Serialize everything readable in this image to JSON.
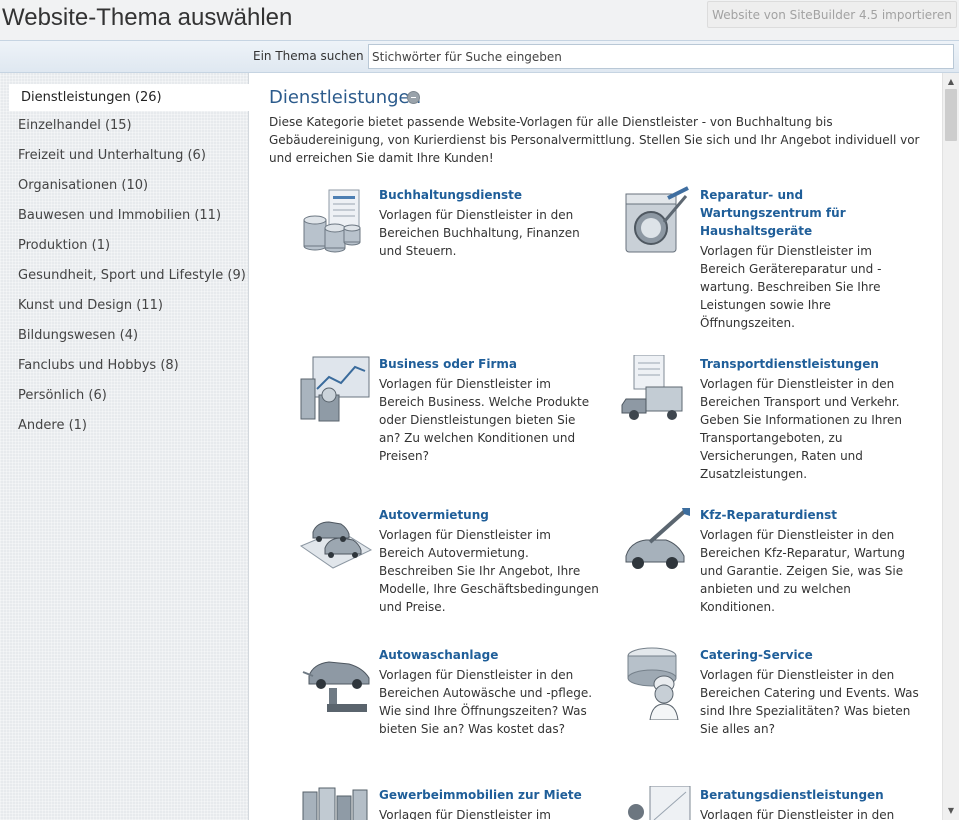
{
  "header": {
    "title": "Website-Thema auswählen",
    "import_button": "Website von SiteBuilder 4.5 importieren"
  },
  "search": {
    "label": "Ein Thema suchen",
    "placeholder": "Stichwörter für Suche eingeben"
  },
  "sidebar": {
    "items": [
      {
        "label": "Dienstleistungen (26)",
        "active": true
      },
      {
        "label": "Einzelhandel (15)"
      },
      {
        "label": "Freizeit und Unterhaltung (6)"
      },
      {
        "label": "Organisationen (10)"
      },
      {
        "label": "Bauwesen und Immobilien (11)"
      },
      {
        "label": "Produktion (1)"
      },
      {
        "label": "Gesundheit, Sport und Lifestyle (9)"
      },
      {
        "label": "Kunst und Design (11)"
      },
      {
        "label": "Bildungswesen (4)"
      },
      {
        "label": "Fanclubs und Hobbys (8)"
      },
      {
        "label": "Persönlich (6)"
      },
      {
        "label": "Andere (1)"
      }
    ]
  },
  "main": {
    "category_title": "Dienstleistungen",
    "category_description": "Diese Kategorie bietet passende Website-Vorlagen für alle Dienstleister - von Buchhaltung bis Gebäudereinigung, von Kurierdienst bis Personalvermittlung. Stellen Sie sich und Ihr Angebot individuell vor und erreichen Sie damit Ihre Kunden!",
    "templates": [
      {
        "title": "Buchhaltungsdienste",
        "icon": "accounting-icon",
        "desc": "Vorlagen für Dienstleister in den Bereichen Buchhaltung, Finanzen und Steuern."
      },
      {
        "title": "Reparatur- und Wartungszentrum für Haushaltsgeräte",
        "icon": "appliance-repair-icon",
        "desc": "Vorlagen für Dienstleister im Bereich Gerätereparatur und -wartung. Beschreiben Sie Ihre Leistungen sowie Ihre Öffnungszeiten."
      },
      {
        "title": "Business oder Firma",
        "icon": "business-icon",
        "desc": "Vorlagen für Dienstleister im Bereich Business. Welche Produkte oder Dienstleistungen bieten Sie an? Zu welchen Konditionen und Preisen?"
      },
      {
        "title": "Transportdienstleistungen",
        "icon": "truck-icon",
        "desc": "Vorlagen für Dienstleister in den Bereichen Transport und Verkehr. Geben Sie Informationen zu Ihren Transportangeboten, zu Versicherungen, Raten und Zusatzleistungen."
      },
      {
        "title": "Autovermietung",
        "icon": "car-rental-icon",
        "desc": "Vorlagen für Dienstleister im Bereich Autovermietung. Beschreiben Sie Ihr Angebot, Ihre Modelle, Ihre Geschäftsbedingungen und Preise."
      },
      {
        "title": "Kfz-Reparaturdienst",
        "icon": "car-repair-icon",
        "desc": "Vorlagen für Dienstleister in den Bereichen Kfz-Reparatur, Wartung und Garantie. Zeigen Sie, was Sie anbieten und zu welchen Konditionen."
      },
      {
        "title": "Autowaschanlage",
        "icon": "car-wash-icon",
        "desc": "Vorlagen für Dienstleister in den Bereichen Autowäsche und -pflege. Wie sind Ihre Öffnungszeiten? Was bieten Sie an? Was kostet das?"
      },
      {
        "title": "Catering-Service",
        "icon": "catering-icon",
        "desc": "Vorlagen für Dienstleister in den Bereichen Catering und Events. Was sind Ihre Spezialitäten? Was bieten Sie alles an?"
      },
      {
        "title": "Gewerbeimmobilien zur Miete",
        "icon": "commercial-property-icon",
        "desc": "Vorlagen für Dienstleister im"
      },
      {
        "title": "Beratungsdienstleistungen",
        "icon": "consulting-icon",
        "desc": "Vorlagen für Dienstleister in den"
      }
    ]
  },
  "colors": {
    "link": "#1f5e99",
    "heading": "#2c5b8c",
    "sidebar_bg": "#e7eaed"
  }
}
